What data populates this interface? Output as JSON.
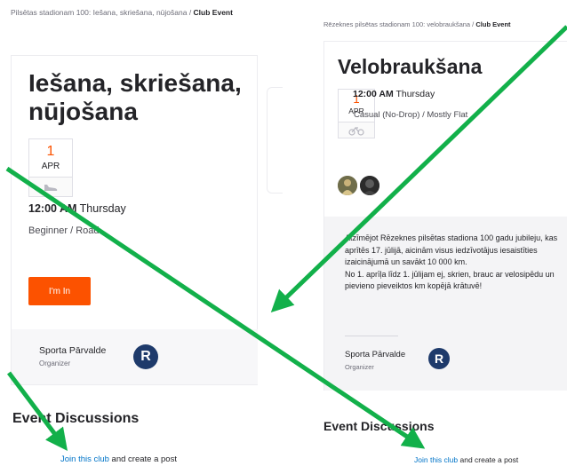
{
  "left": {
    "breadcrumb_prefix": "Pilsētas stadionam 100: Iešana, skriešana, nūjošana / ",
    "breadcrumb_current": "Club Event",
    "title": "Iešana, skriešana, nūjošana",
    "date_day": "1",
    "date_month": "APR",
    "sport_icon": "shoe-icon",
    "time": "12:00 AM",
    "weekday": "Thursday",
    "level": "Beginner / Road",
    "join_button": "I'm In",
    "organizer_name": "Sporta Pārvalde",
    "organizer_role": "Organizer",
    "discussions_heading": "Event Discussions",
    "join_link": "Join this club",
    "join_suffix": " and create a post"
  },
  "right": {
    "breadcrumb_prefix": "Rēzeknes pilsētas stadionam 100: velobraukšana / ",
    "breadcrumb_current": "Club Event",
    "title": "Velobraukšana",
    "date_day": "1",
    "date_month": "APR",
    "sport_icon": "bike-icon",
    "time": "12:00 AM",
    "weekday": "Thursday",
    "level": "Casual (No-Drop) / Mostly Flat",
    "description_1": "Atzīmējot Rēzeknes pilsētas stadiona 100 gadu jubileju, kas aprītēs 17. jūlijā, aicinām visus iedzīvotājus iesaistīties izaicinājumā un savākt 10 000 km.",
    "description_2": "No 1. aprīļa līdz 1. jūlijam ej, skrien, brauc ar velosipēdu un pievieno pieveiktos km kopējā krātuvē!",
    "organizer_name": "Sporta Pārvalde",
    "organizer_role": "Organizer",
    "discussions_heading": "Event Discussions",
    "join_link": "Join this club",
    "join_suffix": " and create a post"
  },
  "logo_letter": "R",
  "colors": {
    "accent": "#fc5200",
    "link": "#0074c8",
    "arrow": "#12b04a",
    "logo": "#1e3a6b"
  }
}
